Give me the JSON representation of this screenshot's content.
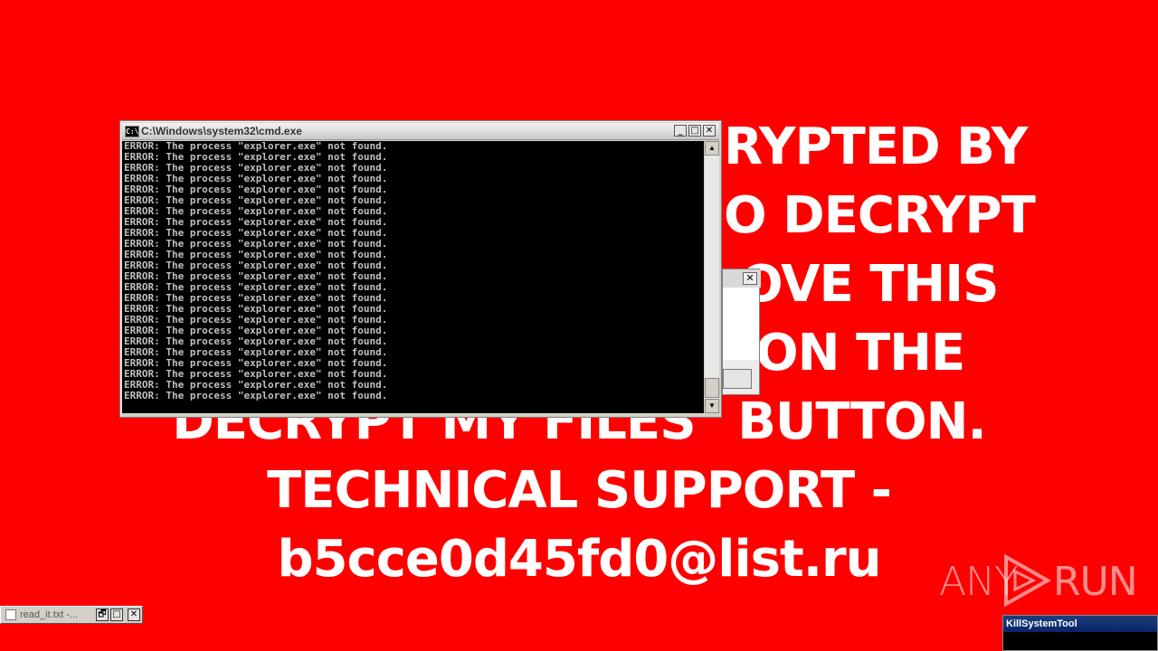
{
  "ransom": {
    "lines": [
      "YOUR FILES HAVE BEEN ENCRYPTED BY",
      "IN ORDER TO DECRYPT",
      "YOUR FILES, REMOVE THIS",
      "TEXT AND CLICK ON THE",
      "DECRYPT MY FILES\"  BUTTON.",
      "TECHNICAL SUPPORT -",
      "b5cce0d45fd0@list.ru"
    ],
    "visible_fragments": [
      "RYPTED BY",
      "O DECRYPT",
      "OVE THIS",
      "ON THE"
    ]
  },
  "cmd_window": {
    "title": "C:\\Windows\\system32\\cmd.exe",
    "icon_label": "C:\\",
    "buttons": {
      "minimize": "_",
      "maximize": "□",
      "close": "✕"
    },
    "output_lines": [
      "ERROR: The process \"explorer.exe\" not found.",
      "ERROR: The process \"explorer.exe\" not found.",
      "ERROR: The process \"explorer.exe\" not found.",
      "ERROR: The process \"explorer.exe\" not found.",
      "ERROR: The process \"explorer.exe\" not found.",
      "ERROR: The process \"explorer.exe\" not found.",
      "ERROR: The process \"explorer.exe\" not found.",
      "ERROR: The process \"explorer.exe\" not found.",
      "ERROR: The process \"explorer.exe\" not found.",
      "ERROR: The process \"explorer.exe\" not found.",
      "ERROR: The process \"explorer.exe\" not found.",
      "ERROR: The process \"explorer.exe\" not found.",
      "ERROR: The process \"explorer.exe\" not found.",
      "ERROR: The process \"explorer.exe\" not found.",
      "ERROR: The process \"explorer.exe\" not found.",
      "ERROR: The process \"explorer.exe\" not found.",
      "ERROR: The process \"explorer.exe\" not found.",
      "ERROR: The process \"explorer.exe\" not found.",
      "ERROR: The process \"explorer.exe\" not found.",
      "ERROR: The process \"explorer.exe\" not found.",
      "ERROR: The process \"explorer.exe\" not found.",
      "ERROR: The process \"explorer.exe\" not found.",
      "ERROR: The process \"explorer.exe\" not found.",
      "ERROR: The process \"explorer.exe\" not found."
    ]
  },
  "dialog": {
    "close": "✕"
  },
  "taskbar_item": {
    "label": "read_it.txt -...",
    "restore": "🗗",
    "maximize": "□",
    "close": "✕"
  },
  "kill_tool": {
    "title": "KillSystemTool"
  },
  "watermark": {
    "left": "ANY",
    "right": "RUN"
  },
  "colors": {
    "background": "#ff0000",
    "console_bg": "#000000",
    "console_text": "#c0c0c0"
  }
}
